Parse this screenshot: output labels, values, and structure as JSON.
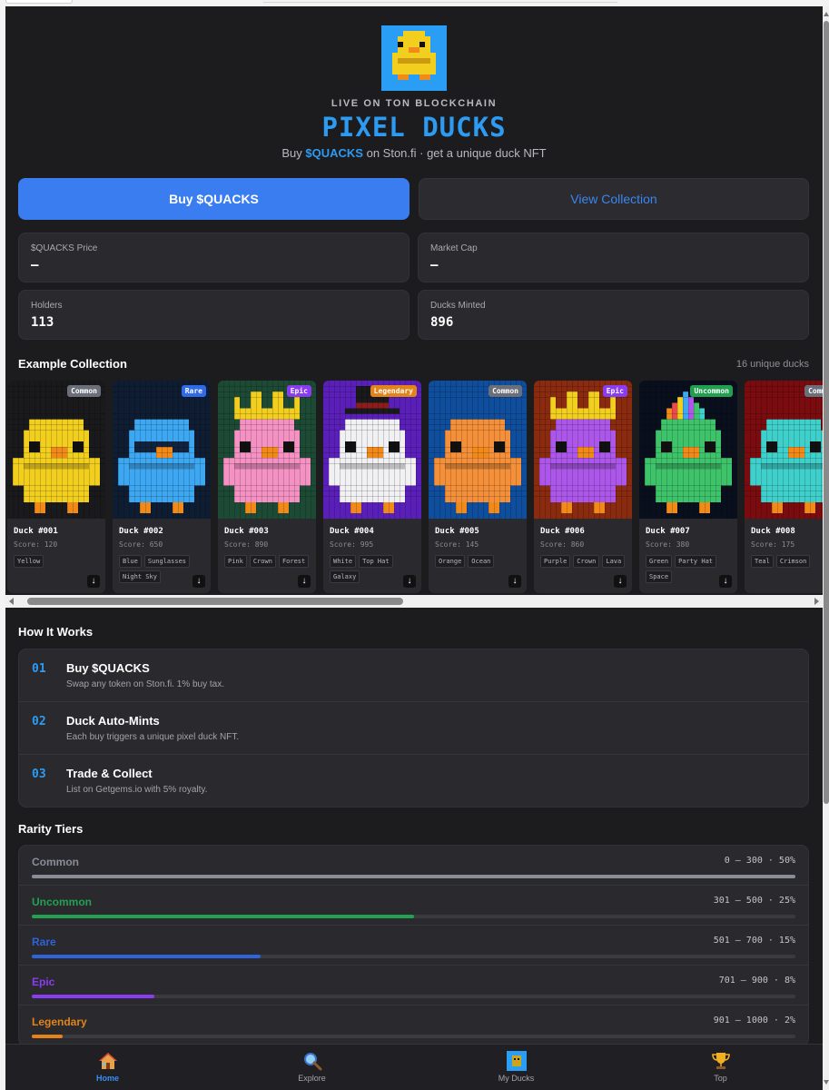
{
  "hero": {
    "eyebrow": "LIVE ON TON BLOCKCHAIN",
    "title": "PIXEL DUCKS",
    "subtitle_pre": "Buy ",
    "subtitle_token": "$QUACKS",
    "subtitle_post": " on Ston.fi · get a unique duck NFT"
  },
  "actions": {
    "buy_label": "Buy $QUACKS",
    "collection_label": "View Collection"
  },
  "stats": [
    {
      "label": "$QUACKS Price",
      "value": "—"
    },
    {
      "label": "Market Cap",
      "value": "—"
    },
    {
      "label": "Holders",
      "value": "113"
    },
    {
      "label": "Ducks Minted",
      "value": "896"
    }
  ],
  "collection": {
    "title": "Example Collection",
    "count_label": "16 unique ducks",
    "download_glyph": "↓",
    "ducks": [
      {
        "name": "Duck #001",
        "score": "Score: 120",
        "rarity": "Common",
        "badge_color": "#6b6f7a",
        "bg": "#1a1a1d",
        "body": "#f2cf1f",
        "accessory": "none",
        "tags": [
          "Yellow"
        ]
      },
      {
        "name": "Duck #002",
        "score": "Score: 650",
        "rarity": "Rare",
        "badge_color": "#2f6ae8",
        "bg": "#0f1d33",
        "body": "#3da7f2",
        "accessory": "sunglasses",
        "tags": [
          "Blue",
          "Sunglasses",
          "Night Sky"
        ]
      },
      {
        "name": "Duck #003",
        "score": "Score: 890",
        "rarity": "Epic",
        "badge_color": "#8a3cf0",
        "bg": "#1d4a34",
        "body": "#f592c4",
        "accessory": "crown",
        "tags": [
          "Pink",
          "Crown",
          "Forest"
        ]
      },
      {
        "name": "Duck #004",
        "score": "Score: 995",
        "rarity": "Legendary",
        "badge_color": "#e2841a",
        "bg": "#5a1fb8",
        "body": "#f1f1f4",
        "accessory": "tophat",
        "tags": [
          "White",
          "Top Hat",
          "Galaxy"
        ]
      },
      {
        "name": "Duck #005",
        "score": "Score: 145",
        "rarity": "Common",
        "badge_color": "#6b6f7a",
        "bg": "#0f4e9c",
        "body": "#f5903a",
        "accessory": "none",
        "tags": [
          "Orange",
          "Ocean"
        ]
      },
      {
        "name": "Duck #006",
        "score": "Score: 860",
        "rarity": "Epic",
        "badge_color": "#8a3cf0",
        "bg": "#8a2a0e",
        "body": "#ad57ea",
        "accessory": "crown",
        "tags": [
          "Purple",
          "Crown",
          "Lava"
        ]
      },
      {
        "name": "Duck #007",
        "score": "Score: 380",
        "rarity": "Uncommon",
        "badge_color": "#21a150",
        "bg": "#0a0f1d",
        "body": "#3fc36a",
        "accessory": "partyhat",
        "tags": [
          "Green",
          "Party Hat",
          "Space"
        ]
      },
      {
        "name": "Duck #008",
        "score": "Score: 175",
        "rarity": "Common",
        "badge_color": "#6b6f7a",
        "bg": "#7a0b0e",
        "body": "#3fd0cb",
        "accessory": "none",
        "tags": [
          "Teal",
          "Crimson"
        ]
      }
    ]
  },
  "how": {
    "title": "How It Works",
    "steps": [
      {
        "num": "01",
        "title": "Buy $QUACKS",
        "desc": "Swap any token on Ston.fi. 1% buy tax."
      },
      {
        "num": "02",
        "title": "Duck Auto-Mints",
        "desc": "Each buy triggers a unique pixel duck NFT."
      },
      {
        "num": "03",
        "title": "Trade & Collect",
        "desc": "List on Getgems.io with 5% royalty."
      }
    ]
  },
  "rarity": {
    "title": "Rarity Tiers",
    "tiers": [
      {
        "name": "Common",
        "range": "0 – 300 · 50%",
        "percent": 100,
        "color": "#8a8d98"
      },
      {
        "name": "Uncommon",
        "range": "301 – 500 · 25%",
        "percent": 50,
        "color": "#22a152"
      },
      {
        "name": "Rare",
        "range": "501 – 700 · 15%",
        "percent": 30,
        "color": "#2f63d9"
      },
      {
        "name": "Epic",
        "range": "701 – 900 · 8%",
        "percent": 16,
        "color": "#8a3cf0"
      },
      {
        "name": "Legendary",
        "range": "901 – 1000 · 2%",
        "percent": 4,
        "color": "#e2841a"
      }
    ]
  },
  "nav": [
    {
      "label": "Home",
      "icon": "house-icon",
      "active": true
    },
    {
      "label": "Explore",
      "icon": "magnifier-icon",
      "active": false
    },
    {
      "label": "My Ducks",
      "icon": "duck-avatar-icon",
      "active": false
    },
    {
      "label": "Top",
      "icon": "trophy-icon",
      "active": false
    }
  ]
}
